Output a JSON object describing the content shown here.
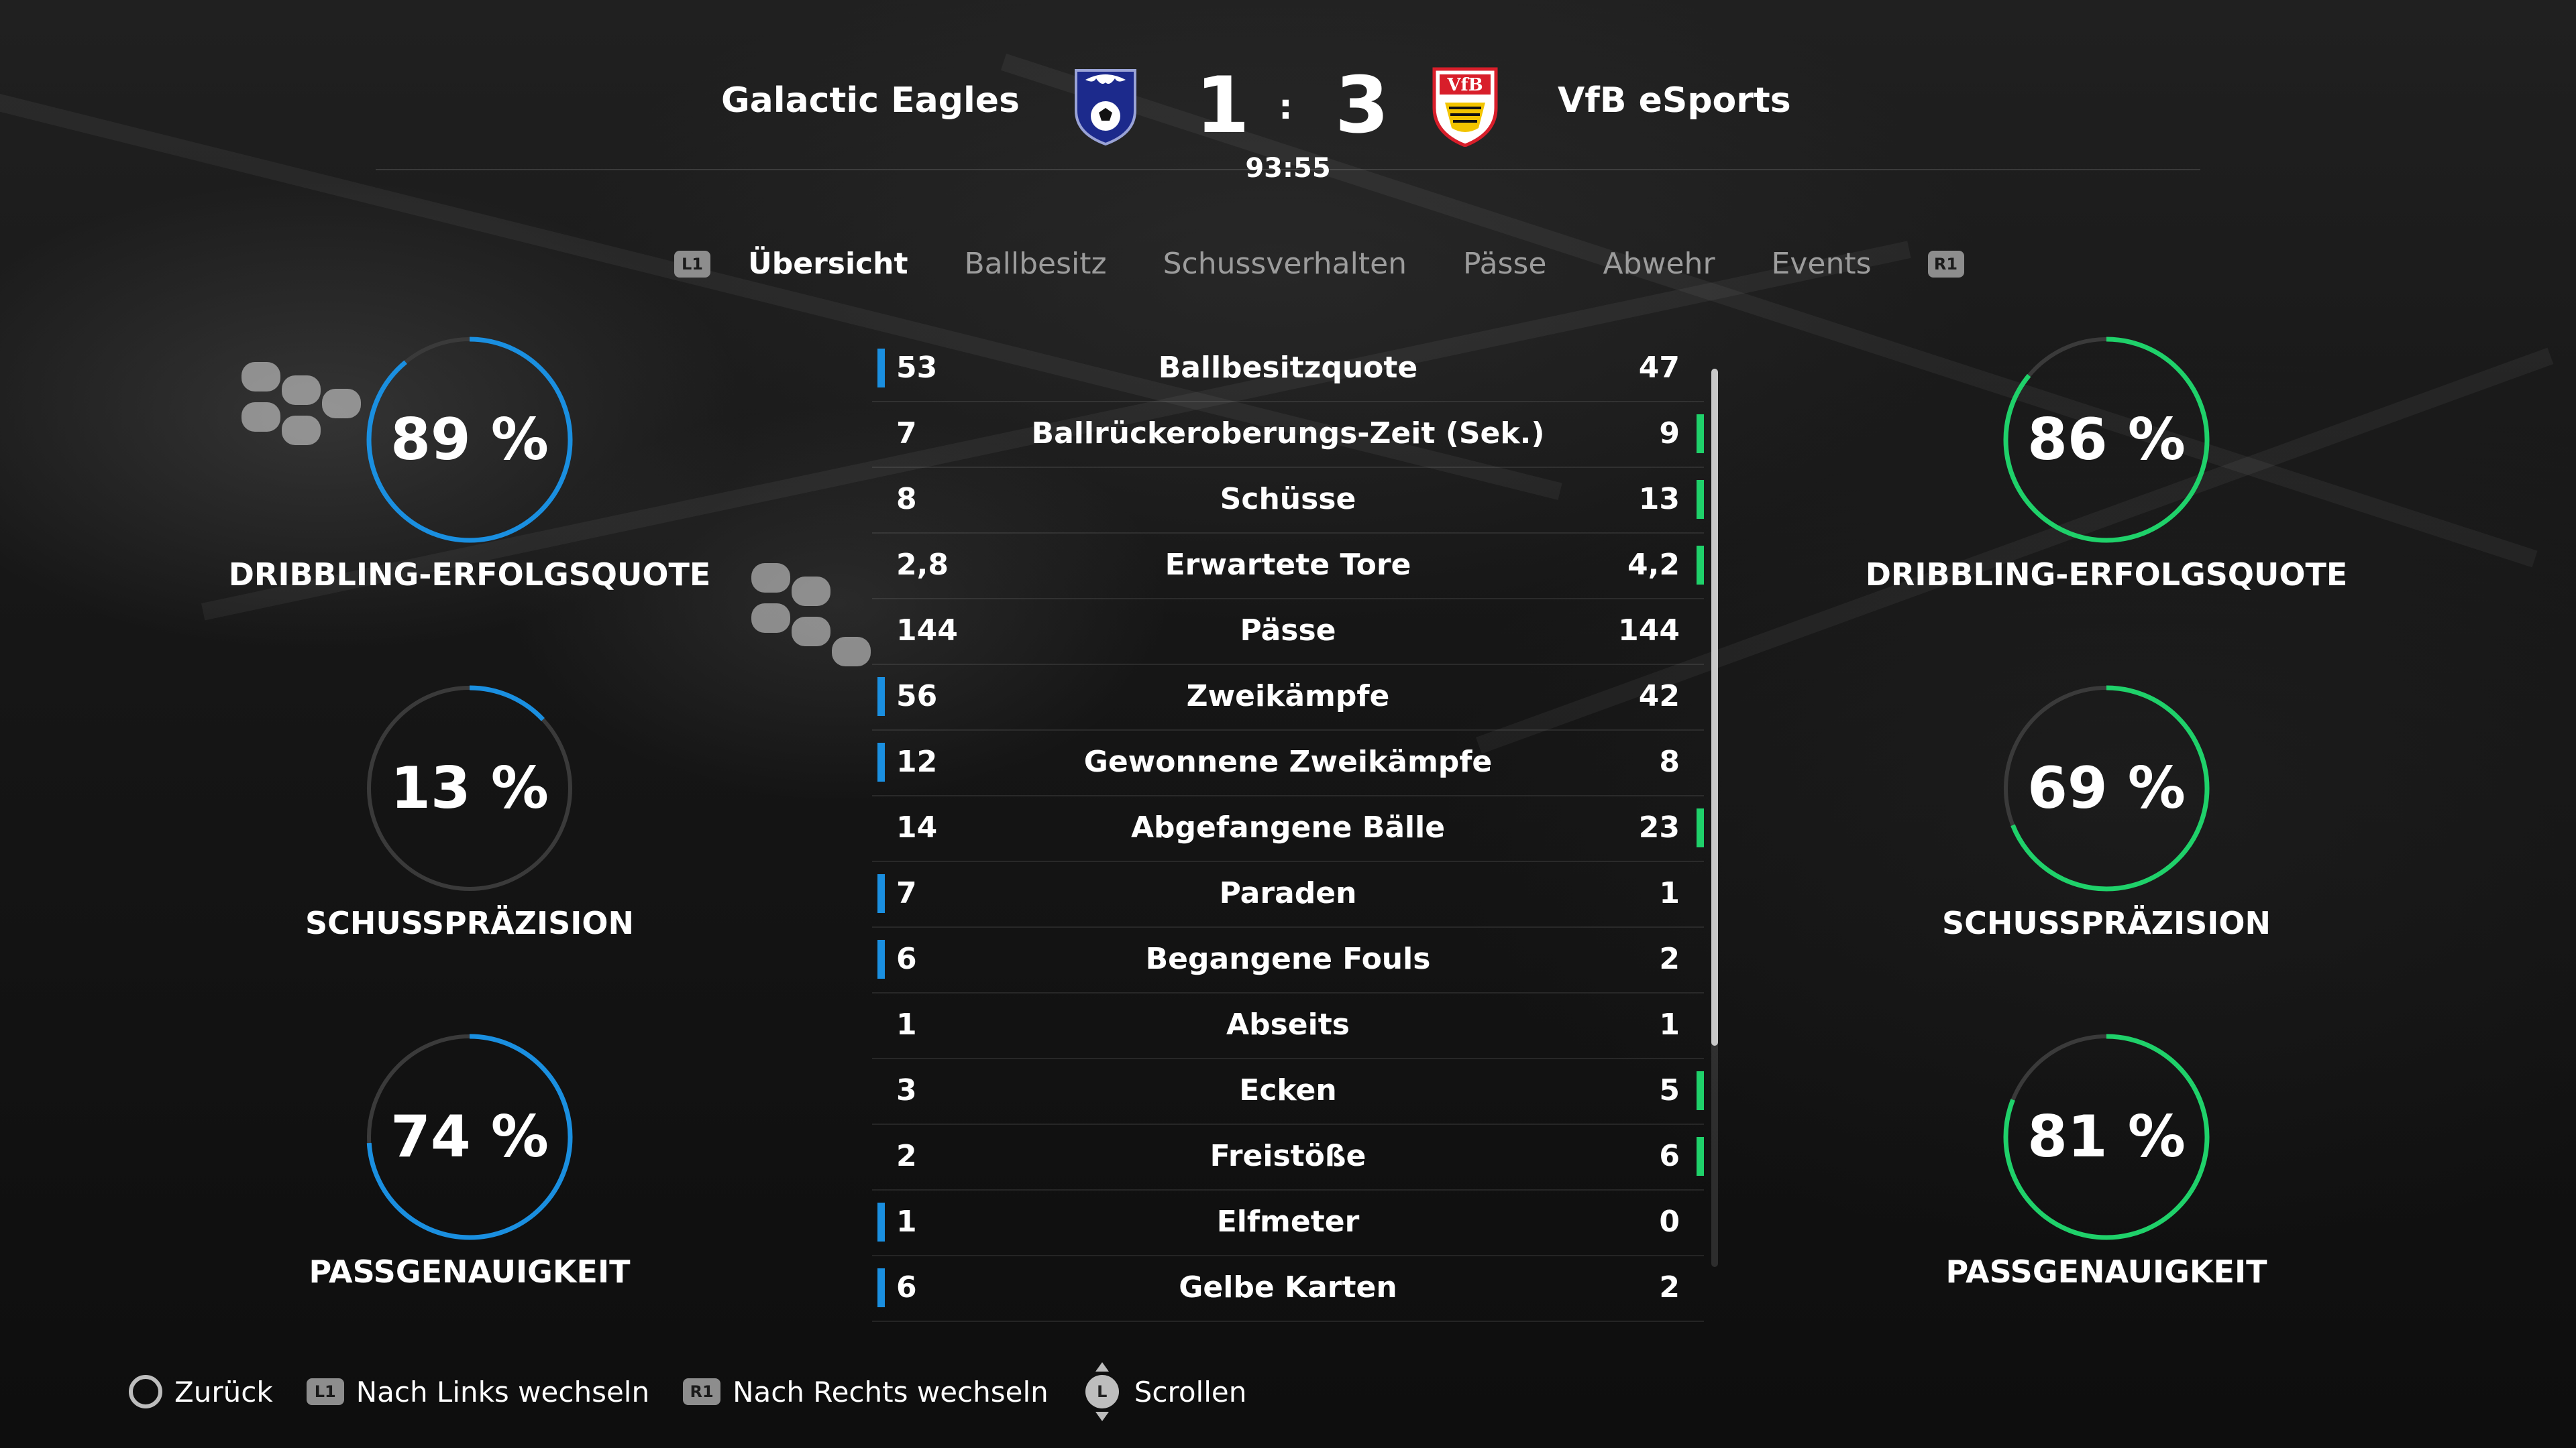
{
  "match": {
    "home_team": "Galactic Eagles",
    "away_team": "VfB eSports",
    "home_score": "1",
    "away_score": "3",
    "separator": ":",
    "time": "93:55",
    "home_crest_icon": "eagle-crest-icon",
    "away_crest_icon": "vfb-crest-icon"
  },
  "tabs": {
    "left_bumper": "L1",
    "right_bumper": "R1",
    "items": [
      "Übersicht",
      "Ballbesitz",
      "Schussverhalten",
      "Pässe",
      "Abwehr",
      "Events"
    ],
    "active_index": 0
  },
  "rings": {
    "home": [
      {
        "value": 89,
        "text": "89 %",
        "label": "DRIBBLING-ERFOLGSQUOTE"
      },
      {
        "value": 13,
        "text": "13 %",
        "label": "SCHUSSPRÄZISION"
      },
      {
        "value": 74,
        "text": "74 %",
        "label": "PASSGENAUIGKEIT"
      }
    ],
    "away": [
      {
        "value": 86,
        "text": "86 %",
        "label": "DRIBBLING-ERFOLGSQUOTE"
      },
      {
        "value": 69,
        "text": "69 %",
        "label": "SCHUSSPRÄZISION"
      },
      {
        "value": 81,
        "text": "81 %",
        "label": "PASSGENAUIGKEIT"
      }
    ]
  },
  "stats": [
    {
      "home": "53",
      "name": "Ballbesitzquote",
      "away": "47",
      "leader": "home"
    },
    {
      "home": "7",
      "name": "Ballrückeroberungs-Zeit (Sek.)",
      "away": "9",
      "leader": "away"
    },
    {
      "home": "8",
      "name": "Schüsse",
      "away": "13",
      "leader": "away"
    },
    {
      "home": "2,8",
      "name": "Erwartete Tore",
      "away": "4,2",
      "leader": "away"
    },
    {
      "home": "144",
      "name": "Pässe",
      "away": "144",
      "leader": "none"
    },
    {
      "home": "56",
      "name": "Zweikämpfe",
      "away": "42",
      "leader": "home"
    },
    {
      "home": "12",
      "name": "Gewonnene Zweikämpfe",
      "away": "8",
      "leader": "home"
    },
    {
      "home": "14",
      "name": "Abgefangene Bälle",
      "away": "23",
      "leader": "away"
    },
    {
      "home": "7",
      "name": "Paraden",
      "away": "1",
      "leader": "home"
    },
    {
      "home": "6",
      "name": "Begangene Fouls",
      "away": "2",
      "leader": "home"
    },
    {
      "home": "1",
      "name": "Abseits",
      "away": "1",
      "leader": "none"
    },
    {
      "home": "3",
      "name": "Ecken",
      "away": "5",
      "leader": "away"
    },
    {
      "home": "2",
      "name": "Freistöße",
      "away": "6",
      "leader": "away"
    },
    {
      "home": "1",
      "name": "Elfmeter",
      "away": "0",
      "leader": "home"
    },
    {
      "home": "6",
      "name": "Gelbe Karten",
      "away": "2",
      "leader": "home"
    }
  ],
  "footer": {
    "back_label": "Zurück",
    "left_label": "Nach Links wechseln",
    "right_label": "Nach Rechts wechseln",
    "scroll_label": "Scrollen",
    "left_bumper": "L1",
    "right_bumper": "R1",
    "stick": "L"
  },
  "colors": {
    "home_accent": "#1a8fe0",
    "away_accent": "#1fd16a",
    "ring_track": "#3a3a3a"
  }
}
